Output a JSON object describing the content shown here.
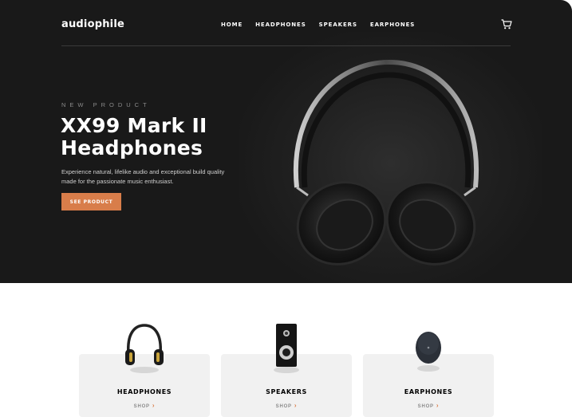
{
  "brand": {
    "logo": "audiophile",
    "accent_color": "#d87d4a"
  },
  "nav": {
    "items": [
      "HOME",
      "HEADPHONES",
      "SPEAKERS",
      "EARPHONES"
    ],
    "cart_icon": "cart-icon"
  },
  "hero": {
    "overline": "NEW PRODUCT",
    "title": "XX99 Mark II Headphones",
    "description": "Experience natural, lifelike audio and exceptional build quality made for the passionate music enthusiast.",
    "cta": "SEE PRODUCT"
  },
  "categories": [
    {
      "title": "HEADPHONES",
      "link": "SHOP"
    },
    {
      "title": "SPEAKERS",
      "link": "SHOP"
    },
    {
      "title": "EARPHONES",
      "link": "SHOP"
    }
  ]
}
